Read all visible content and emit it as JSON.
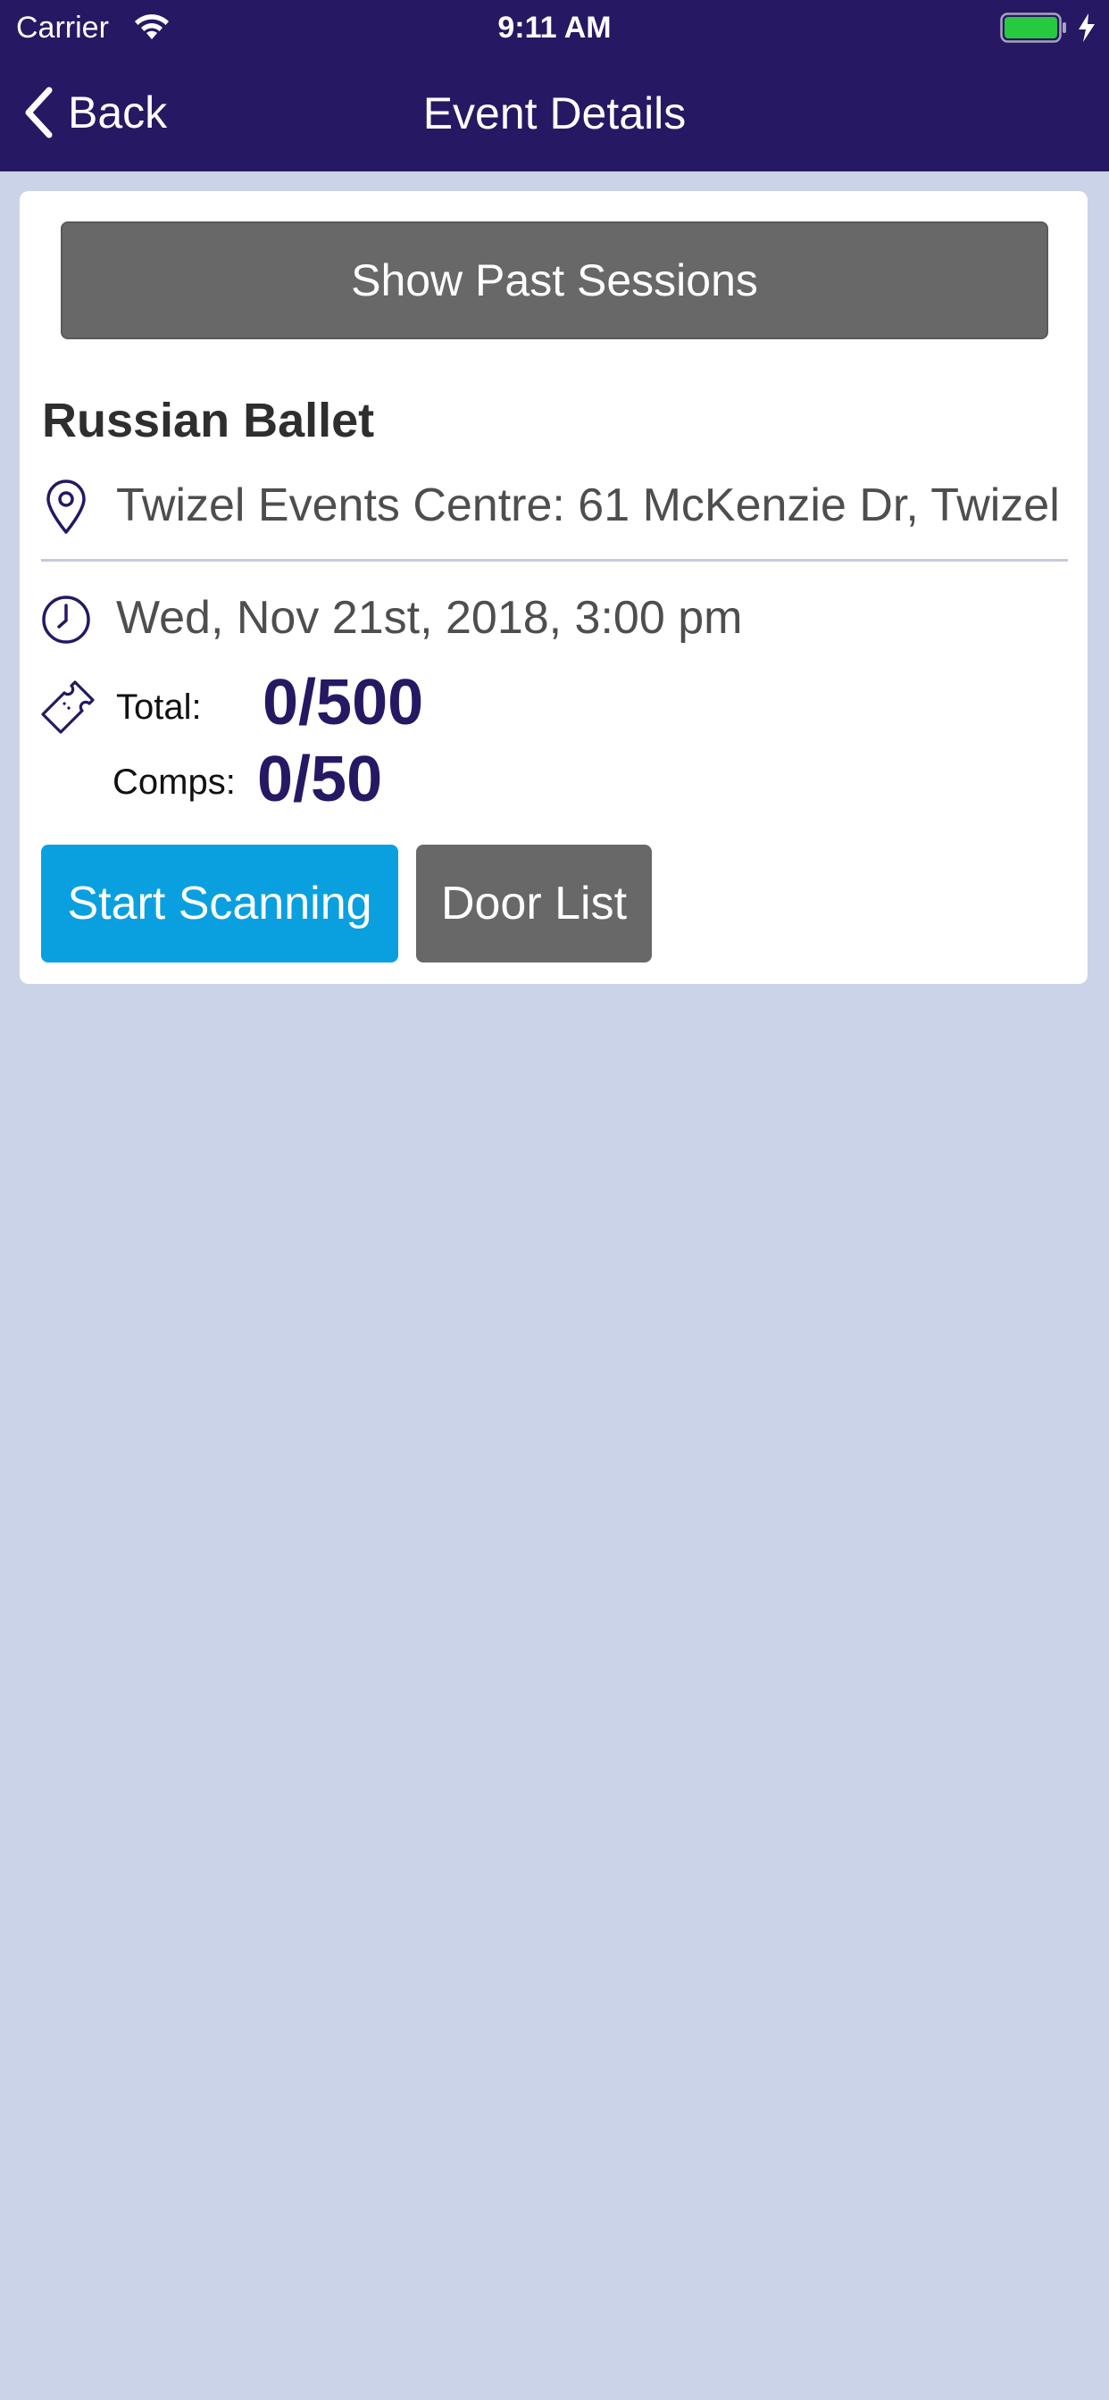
{
  "status_bar": {
    "carrier": "Carrier",
    "time": "9:11 AM",
    "battery_color": "#27c93f"
  },
  "nav": {
    "back_label": "Back",
    "title": "Event Details"
  },
  "event": {
    "past_sessions_label": "Show Past Sessions",
    "title": "Russian Ballet",
    "location": "Twizel Events Centre: 61 McKenzie Dr, Twizel",
    "datetime": "Wed, Nov 21st, 2018, 3:00 pm",
    "total_label": "Total:",
    "total_value": "0/500",
    "comps_label": "Comps:",
    "comps_value": "0/50"
  },
  "actions": {
    "start_scanning": "Start Scanning",
    "door_list": "Door List"
  },
  "colors": {
    "header": "#271863",
    "background": "#cbd3e8",
    "accent": "#0aa0e0",
    "secondary_button": "#686868"
  }
}
